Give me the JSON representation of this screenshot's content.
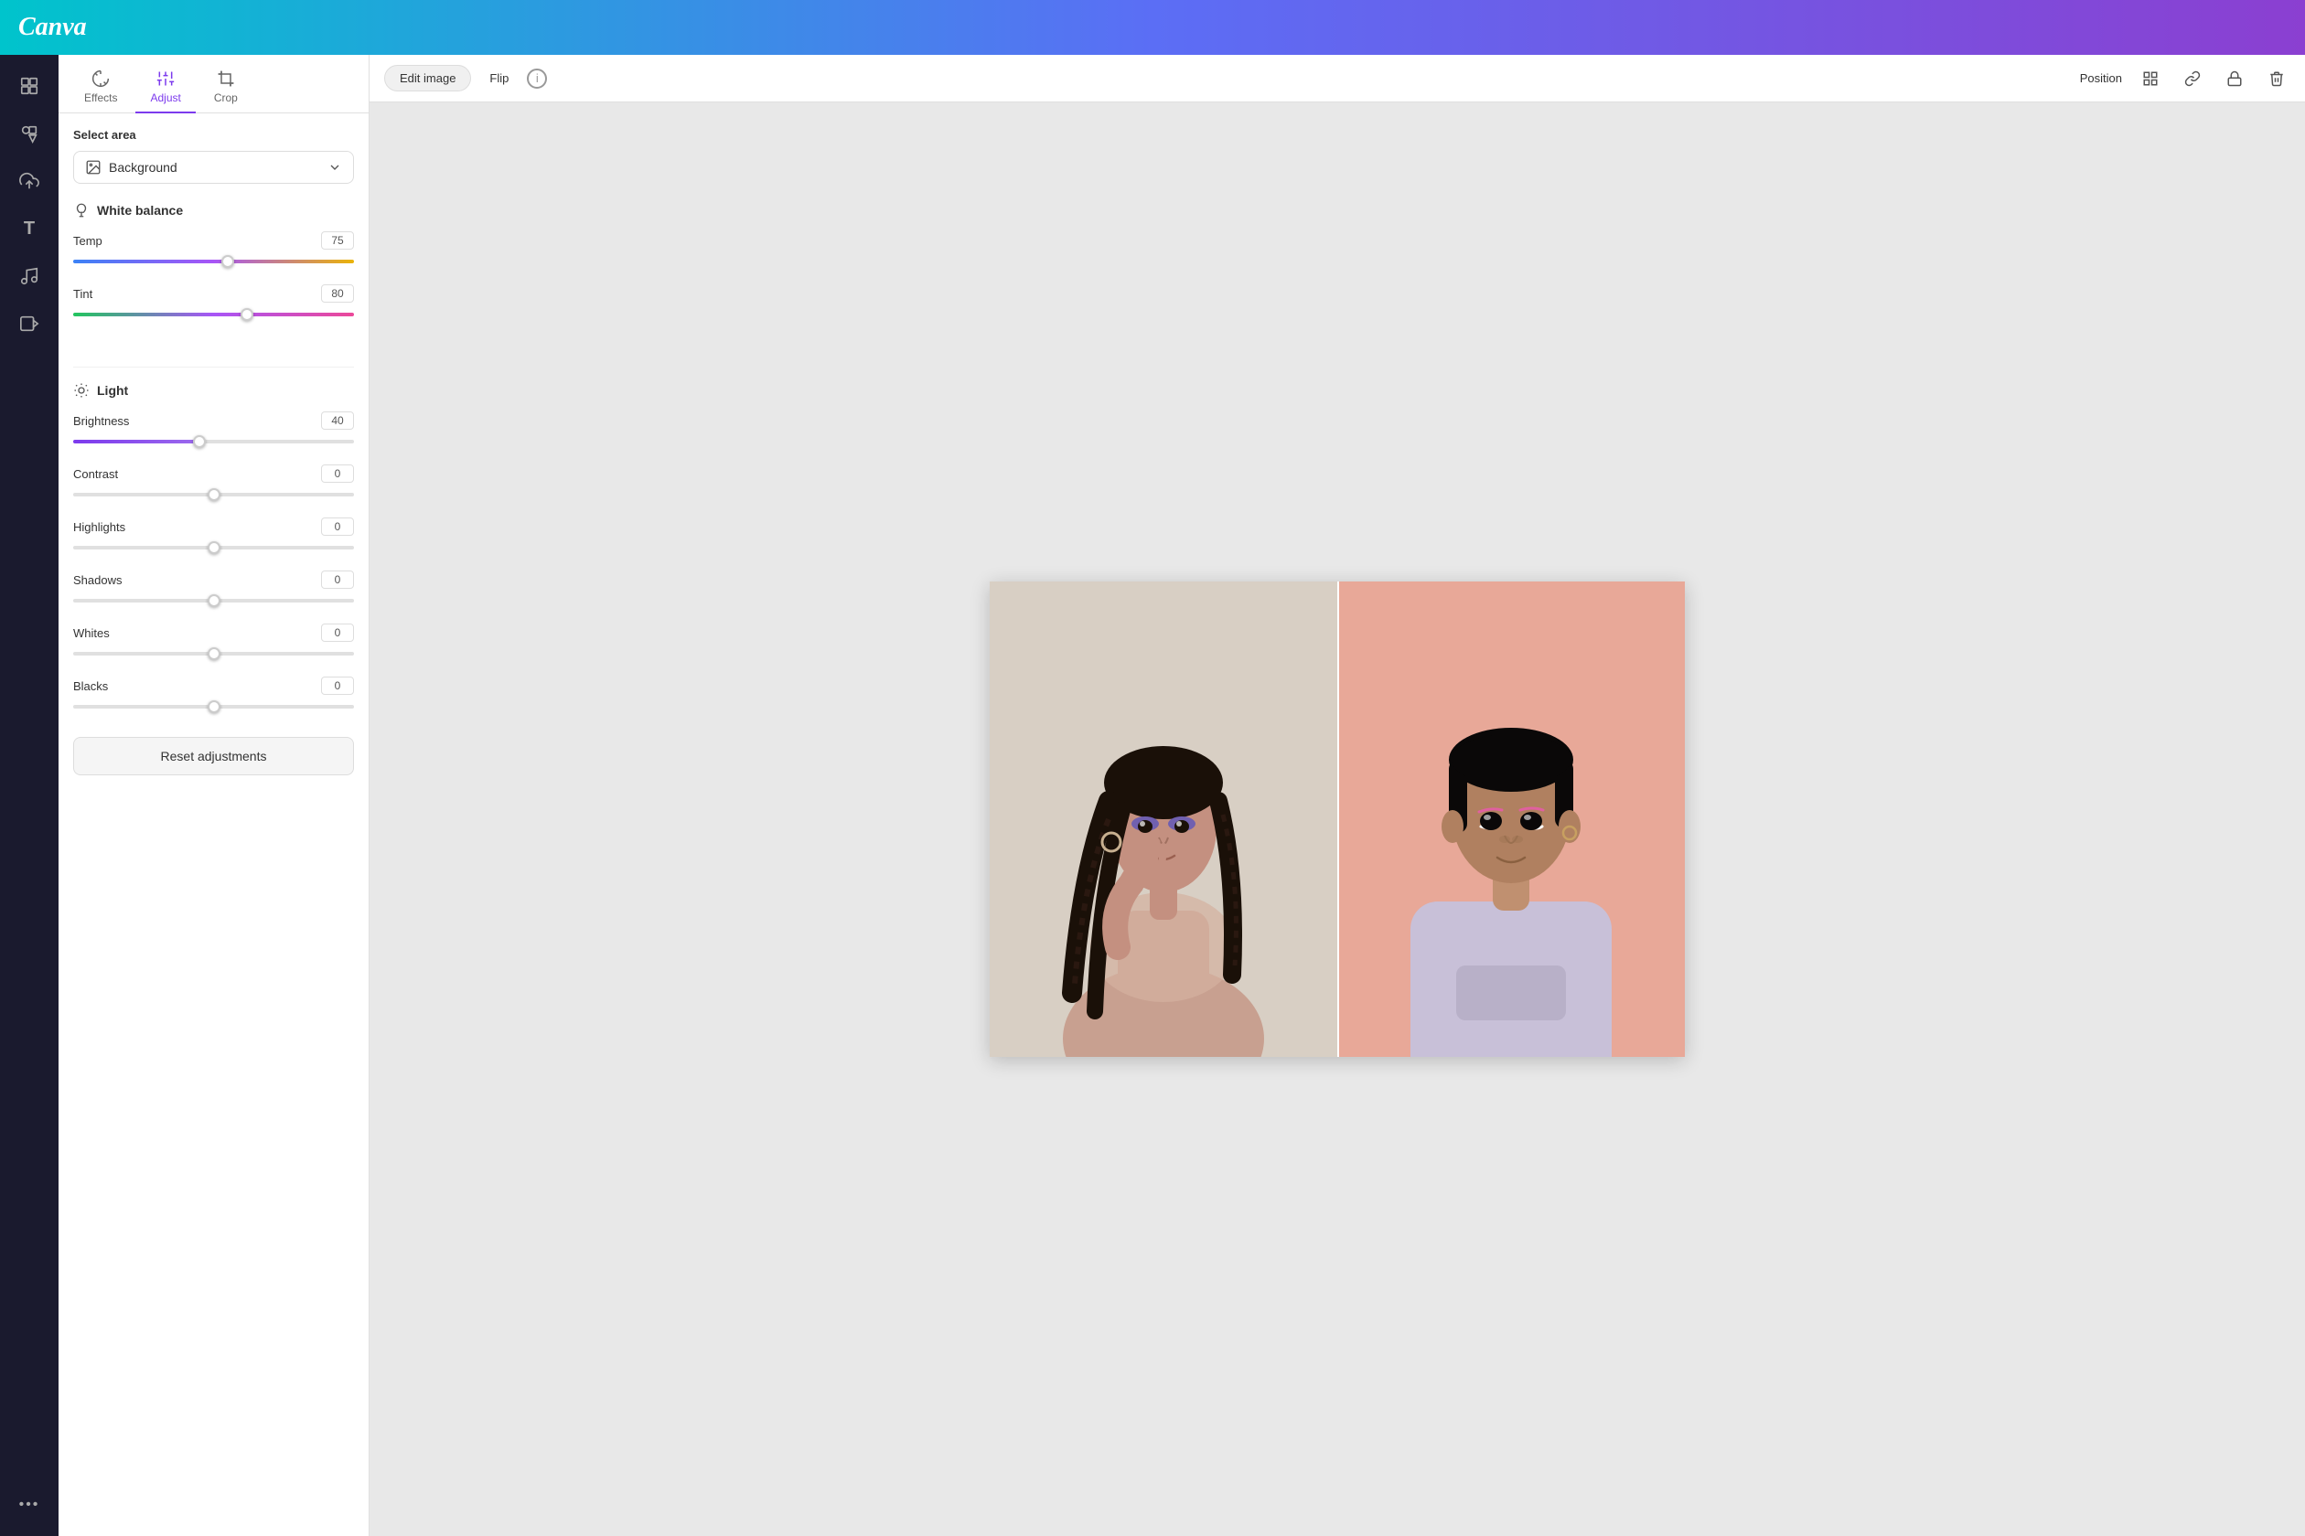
{
  "app": {
    "logo": "Canva"
  },
  "icon_sidebar": {
    "items": [
      {
        "name": "layout-icon",
        "glyph": "⊞",
        "label": "Layout"
      },
      {
        "name": "elements-icon",
        "glyph": "◈",
        "label": "Elements"
      },
      {
        "name": "upload-icon",
        "glyph": "⬆",
        "label": "Upload"
      },
      {
        "name": "text-icon",
        "glyph": "T",
        "label": "Text"
      },
      {
        "name": "music-icon",
        "glyph": "♪",
        "label": "Music"
      },
      {
        "name": "video-icon",
        "glyph": "▶",
        "label": "Video"
      },
      {
        "name": "more-icon",
        "glyph": "•••",
        "label": "More"
      }
    ]
  },
  "tabs": [
    {
      "id": "effects",
      "label": "Effects",
      "active": false
    },
    {
      "id": "adjust",
      "label": "Adjust",
      "active": true
    },
    {
      "id": "crop",
      "label": "Crop",
      "active": false
    }
  ],
  "select_area": {
    "label": "Select area",
    "dropdown_value": "Background",
    "dropdown_icon": "image-icon"
  },
  "white_balance": {
    "section_label": "White balance",
    "temp": {
      "label": "Temp",
      "value": "75",
      "thumb_pct": 55
    },
    "tint": {
      "label": "Tint",
      "value": "80",
      "thumb_pct": 62
    }
  },
  "light": {
    "section_label": "Light",
    "brightness": {
      "label": "Brightness",
      "value": "40",
      "thumb_pct": 45
    },
    "contrast": {
      "label": "Contrast",
      "value": "0",
      "thumb_pct": 50
    },
    "highlights": {
      "label": "Highlights",
      "value": "0",
      "thumb_pct": 50
    },
    "shadows": {
      "label": "Shadows",
      "value": "0",
      "thumb_pct": 50
    },
    "whites": {
      "label": "Whites",
      "value": "0",
      "thumb_pct": 50
    },
    "blacks": {
      "label": "Blacks",
      "value": "0",
      "thumb_pct": 50
    }
  },
  "toolbar": {
    "edit_image_label": "Edit image",
    "flip_label": "Flip",
    "position_label": "Position",
    "info_symbol": "i"
  },
  "reset_btn": {
    "label": "Reset adjustments"
  }
}
